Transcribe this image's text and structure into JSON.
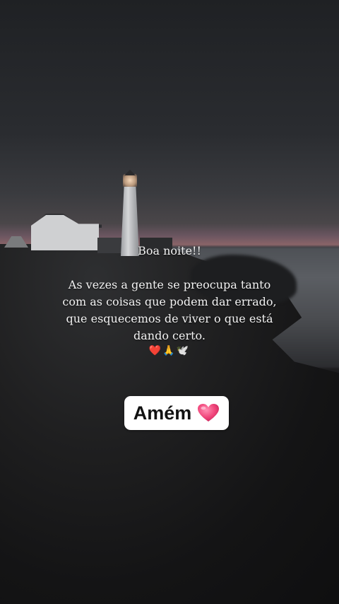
{
  "post": {
    "greeting": "Boa noite!!",
    "message_lines": [
      "As vezes a gente se preocupa tanto",
      "com as coisas que podem dar errado,",
      "que esquecemos de viver o que está",
      "dando certo."
    ],
    "emojis": {
      "heart": "❤️",
      "pray": "🙏",
      "dove": "🕊️"
    }
  },
  "sticker": {
    "label": "Amém",
    "icon": "pink-heart-icon",
    "heart_color": "#f0457a"
  }
}
